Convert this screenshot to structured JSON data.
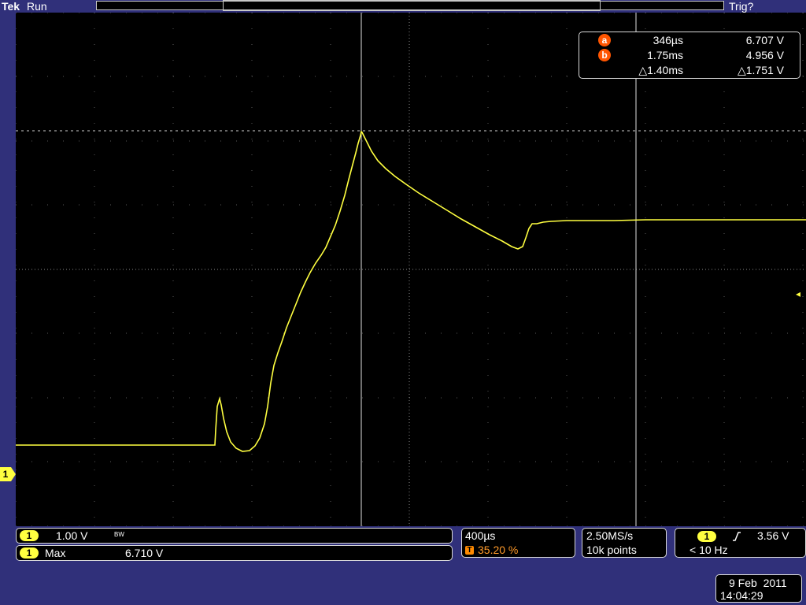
{
  "header": {
    "brand": "Tek",
    "run_state": "Run",
    "trigger_state": "Trig?"
  },
  "trigger_marker": {
    "label": "T"
  },
  "cursors": {
    "a": {
      "label": "a",
      "time": "346µs",
      "value": "6.707 V"
    },
    "b": {
      "label": "b",
      "time": "1.75ms",
      "value": "4.956 V"
    },
    "delta": {
      "time": "△1.40ms",
      "value": "△1.751 V"
    }
  },
  "channel": {
    "number": "1",
    "scale": "1.00 V",
    "bw_mark": "BW",
    "measurement_label": "Max",
    "measurement_value": "6.710 V"
  },
  "timebase": {
    "scale": "400µs",
    "trigger_position_label": "T",
    "trigger_position": "35.20 %"
  },
  "acquisition": {
    "sample_rate": "2.50MS/s",
    "record_length": "10k points"
  },
  "trigger": {
    "source": "1",
    "slope_icon": "rising-edge-icon",
    "level": "3.56 V",
    "frequency": "< 10 Hz"
  },
  "datetime": {
    "date": "9 Feb  2011",
    "time": "14:04:29"
  },
  "colors": {
    "background": "#30307a",
    "screen": "#000000",
    "trace": "#ffff40",
    "cursor": "#ff5500",
    "trigger_marker": "#ff8a00"
  }
}
